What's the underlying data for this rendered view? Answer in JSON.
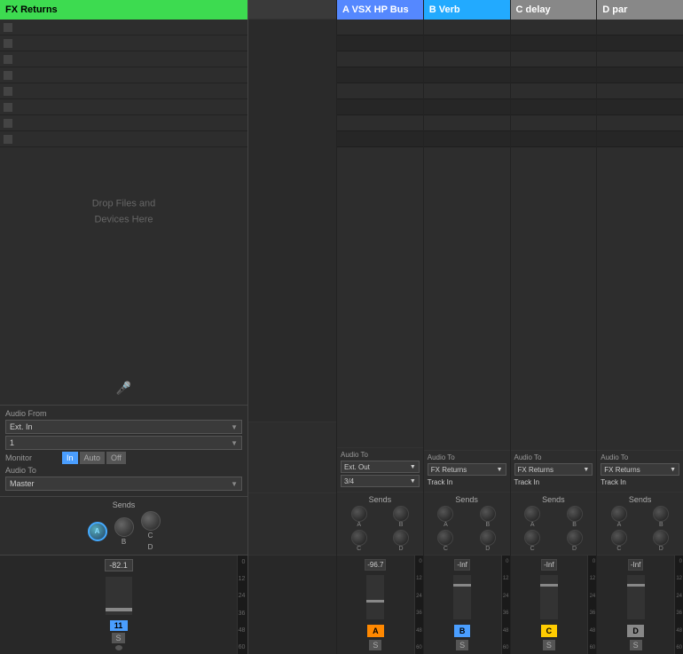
{
  "leftTrack": {
    "name": "FX Returns",
    "audioFrom": {
      "label": "Audio From",
      "source": "Ext. In",
      "channel": "1"
    },
    "monitor": {
      "label": "Monitor",
      "buttons": [
        "In",
        "Auto",
        "Off"
      ],
      "activeIndex": 0
    },
    "audioTo": {
      "label": "Audio To",
      "dest": "Master"
    },
    "sends": {
      "label": "Sends",
      "knobs": [
        "A",
        "B",
        "C",
        "D"
      ]
    },
    "fader": {
      "value": "-82.1",
      "trackLabel": "11",
      "soloLabel": "S",
      "meterTicks": [
        "0",
        "12",
        "24",
        "36",
        "48",
        "60"
      ]
    },
    "dropZone": {
      "line1": "Drop Files and",
      "line2": "Devices Here"
    }
  },
  "channels": [
    {
      "name": "A VSX HP Bus",
      "headerClass": "header-vsx",
      "audioTo": {
        "label": "Audio To",
        "dest": "Ext. Out",
        "subdest": "3/4",
        "trackIn": ""
      },
      "sends": {
        "label": "Sends",
        "knobs": [
          "A",
          "B",
          "C",
          "D"
        ]
      },
      "fader": {
        "value": "-96.7",
        "trackLabel": "A",
        "btnClass": "btn-orange",
        "soloLabel": "S",
        "meterTicks": [
          "0",
          "12",
          "24",
          "36",
          "48",
          "60"
        ]
      }
    },
    {
      "name": "B Verb",
      "headerClass": "header-verb",
      "audioTo": {
        "label": "Audio To",
        "dest": "FX Returns",
        "trackIn": "Track In"
      },
      "sends": {
        "label": "Sends",
        "knobs": [
          "A",
          "B",
          "C",
          "D"
        ]
      },
      "fader": {
        "value": "-Inf",
        "trackLabel": "B",
        "btnClass": "btn-green",
        "soloLabel": "S",
        "meterTicks": [
          "0",
          "12",
          "24",
          "36",
          "48",
          "60"
        ]
      }
    },
    {
      "name": "C delay",
      "headerClass": "header-delay",
      "audioTo": {
        "label": "Audio To",
        "dest": "FX Returns",
        "trackIn": "Track In"
      },
      "sends": {
        "label": "Sends",
        "knobs": [
          "A",
          "B",
          "C",
          "D"
        ]
      },
      "fader": {
        "value": "-Inf",
        "trackLabel": "C",
        "btnClass": "btn-yellow",
        "soloLabel": "S",
        "meterTicks": [
          "0",
          "12",
          "24",
          "36",
          "48",
          "60"
        ]
      }
    },
    {
      "name": "D par",
      "headerClass": "header-par",
      "audioTo": {
        "label": "Audio To",
        "dest": "FX Returns",
        "trackIn": "Track In"
      },
      "sends": {
        "label": "Sends",
        "knobs": [
          "A",
          "B",
          "C",
          "D"
        ]
      },
      "fader": {
        "value": "-Inf",
        "trackLabel": "D",
        "btnClass": "btn-purple",
        "soloLabel": "S",
        "meterTicks": [
          "0",
          "12",
          "24",
          "36",
          "48",
          "60"
        ]
      }
    }
  ],
  "colors": {
    "green": "#3ddb50",
    "blue": "#4a9eff",
    "orange": "#ff8800"
  }
}
